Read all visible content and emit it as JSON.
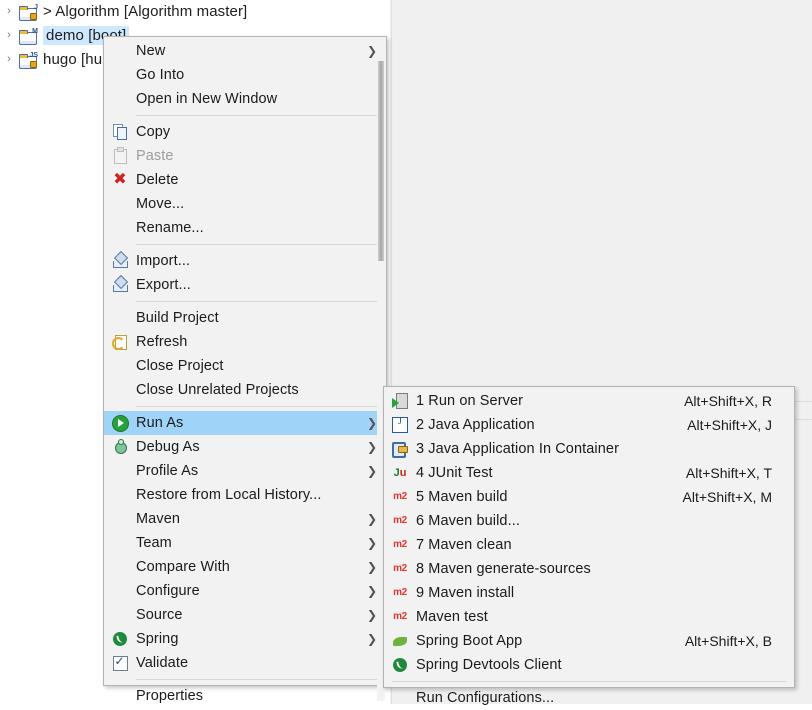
{
  "workspace": {
    "tree": {
      "items": [
        {
          "label": "> Algorithm [Algorithm master]",
          "arrow": "›",
          "deco": "J",
          "selected": false
        },
        {
          "label": "demo [boot]",
          "arrow": "›",
          "deco": "M",
          "selected": true
        },
        {
          "label": "hugo [hu",
          "arrow": "›",
          "deco": "JS",
          "selected": false
        }
      ]
    }
  },
  "context_menu": {
    "name": "project-context-menu",
    "highlight_color": "#9fd3f7",
    "items": [
      {
        "id": "new",
        "label": "New",
        "icon": "",
        "accel": "",
        "submenu": true,
        "separator_after": false
      },
      {
        "id": "go-into",
        "label": "Go Into",
        "icon": "",
        "accel": "",
        "submenu": false,
        "separator_after": false
      },
      {
        "id": "open-in-new-window",
        "label": "Open in New Window",
        "icon": "",
        "accel": "",
        "submenu": false,
        "separator_after": true
      },
      {
        "id": "copy",
        "label": "Copy",
        "icon": "copy-icon",
        "accel": "",
        "submenu": false,
        "separator_after": false
      },
      {
        "id": "paste",
        "label": "Paste",
        "icon": "paste-icon",
        "accel": "",
        "submenu": false,
        "disabled": true,
        "separator_after": false
      },
      {
        "id": "delete",
        "label": "Delete",
        "icon": "delete-icon",
        "accel": "",
        "submenu": false,
        "separator_after": false
      },
      {
        "id": "move",
        "label": "Move...",
        "icon": "",
        "accel": "",
        "submenu": false,
        "separator_after": false
      },
      {
        "id": "rename",
        "label": "Rename...",
        "icon": "",
        "accel": "",
        "submenu": false,
        "separator_after": true
      },
      {
        "id": "import",
        "label": "Import...",
        "icon": "import-icon",
        "accel": "",
        "submenu": false,
        "separator_after": false
      },
      {
        "id": "export",
        "label": "Export...",
        "icon": "export-icon",
        "accel": "",
        "submenu": false,
        "separator_after": true
      },
      {
        "id": "build-project",
        "label": "Build Project",
        "icon": "",
        "accel": "",
        "submenu": false,
        "separator_after": false
      },
      {
        "id": "refresh",
        "label": "Refresh",
        "icon": "refresh-icon",
        "accel": "",
        "submenu": false,
        "separator_after": false
      },
      {
        "id": "close-project",
        "label": "Close Project",
        "icon": "",
        "accel": "",
        "submenu": false,
        "separator_after": false
      },
      {
        "id": "close-unrelated-projects",
        "label": "Close Unrelated Projects",
        "icon": "",
        "accel": "",
        "submenu": false,
        "separator_after": true
      },
      {
        "id": "run-as",
        "label": "Run As",
        "icon": "run-icon",
        "accel": "",
        "submenu": true,
        "highlighted": true,
        "separator_after": false
      },
      {
        "id": "debug-as",
        "label": "Debug As",
        "icon": "debug-icon",
        "accel": "",
        "submenu": true,
        "separator_after": false
      },
      {
        "id": "profile-as",
        "label": "Profile As",
        "icon": "",
        "accel": "",
        "submenu": true,
        "separator_after": false
      },
      {
        "id": "restore-from-local-history",
        "label": "Restore from Local History...",
        "icon": "",
        "accel": "",
        "submenu": false,
        "separator_after": false
      },
      {
        "id": "maven",
        "label": "Maven",
        "icon": "",
        "accel": "",
        "submenu": true,
        "separator_after": false
      },
      {
        "id": "team",
        "label": "Team",
        "icon": "",
        "accel": "",
        "submenu": true,
        "separator_after": false
      },
      {
        "id": "compare-with",
        "label": "Compare With",
        "icon": "",
        "accel": "",
        "submenu": true,
        "separator_after": false
      },
      {
        "id": "configure",
        "label": "Configure",
        "icon": "",
        "accel": "",
        "submenu": true,
        "separator_after": false
      },
      {
        "id": "source",
        "label": "Source",
        "icon": "",
        "accel": "",
        "submenu": true,
        "separator_after": false
      },
      {
        "id": "spring",
        "label": "Spring",
        "icon": "spring-icon",
        "accel": "",
        "submenu": true,
        "separator_after": false
      },
      {
        "id": "validate",
        "label": "Validate",
        "icon": "validate-checkbox-icon",
        "accel": "",
        "submenu": false,
        "separator_after": true
      },
      {
        "id": "properties",
        "label": "Properties",
        "icon": "",
        "accel": "",
        "submenu": false,
        "separator_after": false
      }
    ]
  },
  "run_as_submenu": {
    "name": "run-as-submenu",
    "items": [
      {
        "id": "run-on-server",
        "label": "1 Run on Server",
        "icon": "server-icon",
        "accel": "Alt+Shift+X, R",
        "separator_after": false
      },
      {
        "id": "java-application",
        "label": "2 Java Application",
        "icon": "java-icon",
        "accel": "Alt+Shift+X, J",
        "separator_after": false
      },
      {
        "id": "java-application-in-container",
        "label": "3 Java Application In Container",
        "icon": "container-icon",
        "accel": "",
        "separator_after": false
      },
      {
        "id": "junit-test",
        "label": "4 JUnit Test",
        "icon": "junit-icon",
        "accel": "Alt+Shift+X, T",
        "separator_after": false
      },
      {
        "id": "maven-build",
        "label": "5 Maven build",
        "icon": "maven-icon",
        "accel": "Alt+Shift+X, M",
        "separator_after": false
      },
      {
        "id": "maven-build-dialog",
        "label": "6 Maven build...",
        "icon": "maven-icon",
        "accel": "",
        "separator_after": false
      },
      {
        "id": "maven-clean",
        "label": "7 Maven clean",
        "icon": "maven-icon",
        "accel": "",
        "separator_after": false
      },
      {
        "id": "maven-generate-sources",
        "label": "8 Maven generate-sources",
        "icon": "maven-icon",
        "accel": "",
        "separator_after": false
      },
      {
        "id": "maven-install",
        "label": "9 Maven install",
        "icon": "maven-icon",
        "accel": "",
        "separator_after": false
      },
      {
        "id": "maven-test",
        "label": "Maven test",
        "icon": "maven-icon",
        "accel": "",
        "separator_after": false
      },
      {
        "id": "spring-boot-app",
        "label": "Spring Boot App",
        "icon": "spring-boot-icon",
        "accel": "Alt+Shift+X, B",
        "separator_after": false
      },
      {
        "id": "spring-devtools-client",
        "label": "Spring Devtools Client",
        "icon": "spring-devtools-icon",
        "accel": "",
        "separator_after": true
      },
      {
        "id": "run-configurations",
        "label": "Run Configurations...",
        "icon": "",
        "accel": "",
        "separator_after": false
      }
    ]
  }
}
